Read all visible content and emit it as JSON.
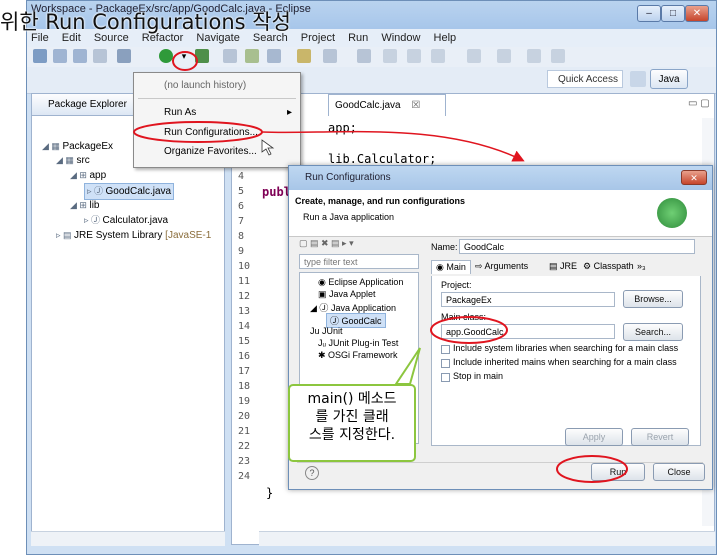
{
  "heading": "을 위한 Run Configurations 작성",
  "window": {
    "title": "Workspace - PackageEx/src/app/GoodCalc.java - Eclipse"
  },
  "menubar": [
    "File",
    "Edit",
    "Source",
    "Refactor",
    "Navigate",
    "Search",
    "Project",
    "Run",
    "Window",
    "Help"
  ],
  "toolbar": {
    "quick_access": "Quick Access",
    "perspective": "Java"
  },
  "package_explorer": {
    "title": "Package Explorer",
    "tree": [
      "PackageEx",
      "src",
      "app",
      "GoodCalc.java",
      "lib",
      "Calculator.java",
      "JRE System Library",
      "[JavaSE-1"
    ]
  },
  "popup": {
    "items": [
      "(no launch history)",
      "Run As",
      "Run Configurations...",
      "Organize Favorites..."
    ]
  },
  "editor": {
    "tab": "GoodCalc.java",
    "tab_close": "☒",
    "line_numbers": [
      "4",
      "5",
      "6",
      "7",
      "8",
      "9",
      "10",
      "11",
      "12",
      "13",
      "14",
      "15",
      "16",
      "17",
      "18",
      "19",
      "20",
      "21",
      "22",
      "23",
      "24"
    ],
    "code": {
      "l1": "app;",
      "l3": "lib.Calculator;",
      "l5": "publ",
      "l24": "}"
    }
  },
  "dialog": {
    "title": "Run Configurations",
    "header_title": "Create, manage, and run configurations",
    "header_sub": "Run a Java application",
    "filter_placeholder": "type filter text",
    "config_tree": [
      "Eclipse Application",
      "Java Applet",
      "Java Application",
      "GoodCalc",
      "JUnit",
      "JUnit Plug-in Test",
      "OSGi Framework"
    ],
    "name_label": "Name:",
    "name_value": "GoodCalc",
    "tabs": [
      "Main",
      "Arguments",
      "JRE",
      "Classpath",
      "»₃"
    ],
    "project_label": "Project:",
    "project_value": "PackageEx",
    "browse": "Browse...",
    "main_class_label": "Main class:",
    "main_class_value": "app.GoodCalc",
    "search": "Search...",
    "checks": [
      "Include system libraries when searching for a main class",
      "Include inherited mains when searching for a main class",
      "Stop in main"
    ],
    "apply": "Apply",
    "revert": "Revert",
    "run": "Run",
    "close": "Close"
  },
  "callout": {
    "line1": "main() 메소드",
    "line2": "를 가진 클래",
    "line3": "스를 지정한다."
  },
  "colors": {
    "highlight": "#e0151f",
    "callout_border": "#8cc63f",
    "selection": "#cfe1f7"
  }
}
